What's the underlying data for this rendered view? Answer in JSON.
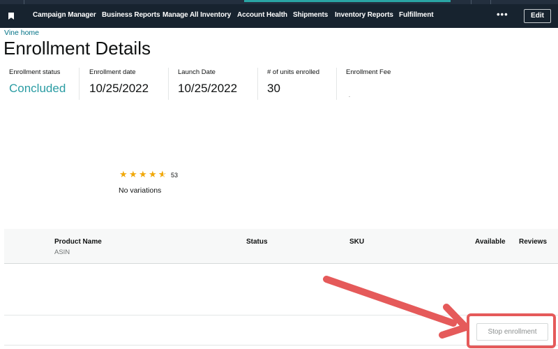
{
  "nav": {
    "items": [
      "Campaign Manager",
      "Business Reports",
      "Manage All Inventory",
      "Account Health",
      "Shipments",
      "Inventory Reports",
      "Fulfillment"
    ],
    "more": "•••",
    "edit_label": "Edit"
  },
  "breadcrumb": "Vine home",
  "title": "Enrollment Details",
  "stats": {
    "status": {
      "label": "Enrollment status",
      "value": "Concluded"
    },
    "enrollment_date": {
      "label": "Enrollment date",
      "value": "10/25/2022"
    },
    "launch_date": {
      "label": "Launch Date",
      "value": "10/25/2022"
    },
    "units": {
      "label": "# of units enrolled",
      "value": "30"
    },
    "fee": {
      "label": "Enrollment Fee",
      "value": ""
    }
  },
  "product": {
    "rating": 4.5,
    "rating_max": 5,
    "review_count": "53",
    "variations": "No variations"
  },
  "table": {
    "headers": {
      "product_name": "Product Name",
      "asin": "ASIN",
      "status": "Status",
      "sku": "SKU",
      "available": "Available",
      "reviews": "Reviews"
    }
  },
  "actions": {
    "stop_label": "Stop enrollment"
  },
  "colors": {
    "nav_bg": "#17232f",
    "accent_teal": "#2a9ca3",
    "link": "#007185",
    "star": "#f0a80a",
    "annotation": "#e55a5a"
  }
}
